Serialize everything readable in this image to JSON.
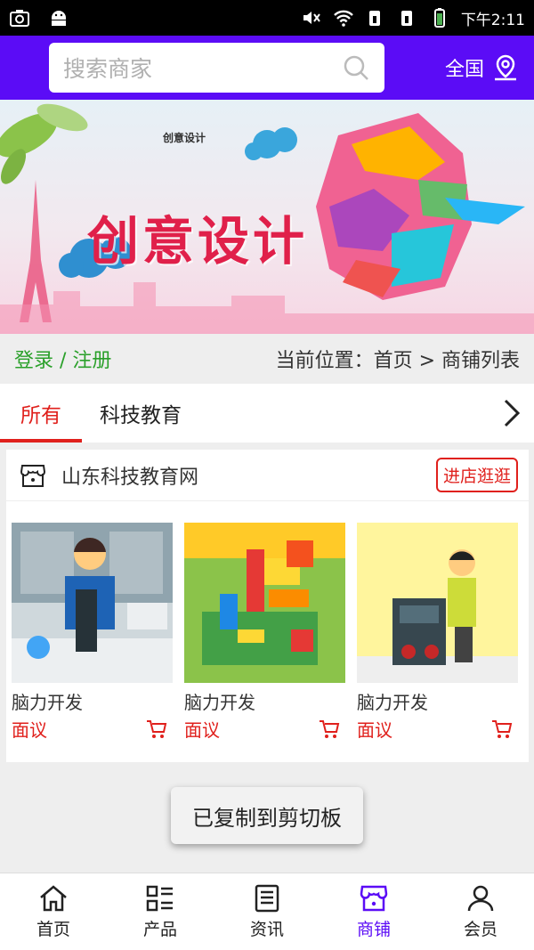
{
  "statusbar": {
    "time": "下午2:11"
  },
  "header": {
    "search_placeholder": "搜索商家",
    "region": "全国"
  },
  "banner": {
    "title": "创意设计",
    "brand": "创意设计"
  },
  "locbar": {
    "login": "登录 / 注册",
    "breadcrumb": "当前位置：首页 > 商铺列表"
  },
  "tabs": [
    {
      "label": "所有",
      "active": true
    },
    {
      "label": "科技教育",
      "active": false
    }
  ],
  "shop": {
    "name": "山东科技教育网",
    "enter_button": "进店逛逛",
    "products": [
      {
        "name": "脑力开发",
        "price": "面议"
      },
      {
        "name": "脑力开发",
        "price": "面议"
      },
      {
        "name": "脑力开发",
        "price": "面议"
      }
    ]
  },
  "toast": "已复制到剪切板",
  "bottom_nav": [
    {
      "label": "首页",
      "icon": "home-icon",
      "active": false
    },
    {
      "label": "产品",
      "icon": "grid-list-icon",
      "active": false
    },
    {
      "label": "资讯",
      "icon": "news-icon",
      "active": false
    },
    {
      "label": "商铺",
      "icon": "store-icon",
      "active": true
    },
    {
      "label": "会员",
      "icon": "user-icon",
      "active": false
    }
  ],
  "colors": {
    "primary": "#5b0cf6",
    "accent_red": "#e0201c",
    "login_green": "#2aa02a"
  }
}
